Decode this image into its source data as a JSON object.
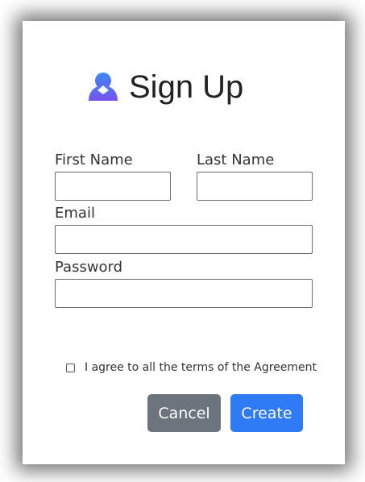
{
  "header": {
    "icon": "user-icon",
    "title": "Sign Up"
  },
  "form": {
    "first_name_label": "First Name",
    "first_name_value": "",
    "last_name_label": "Last Name",
    "last_name_value": "",
    "email_label": "Email",
    "email_value": "",
    "password_label": "Password",
    "password_value": ""
  },
  "terms": {
    "checked": false,
    "label": "I agree to all the terms of the Agreement"
  },
  "buttons": {
    "cancel_label": "Cancel",
    "create_label": "Create"
  },
  "colors": {
    "accent": "#2f7bf5",
    "cancel": "#6c757d"
  }
}
